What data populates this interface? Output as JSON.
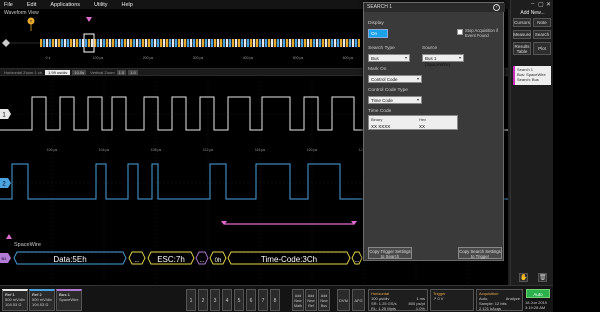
{
  "menu": [
    "File",
    "Edit",
    "Applications",
    "Utility",
    "Help"
  ],
  "waveform": {
    "title": "Waveform View",
    "zoom_bar": {
      "horizontal_zoom_label": "Horizontal Zoom 1 ch",
      "horizontal_zoom_value": "1.99 us/div",
      "position_label": "10.0s",
      "position_value": "10.0s",
      "vertical_zoom_label": "Vertical Zoom",
      "vertical_zoom_value": "1.0",
      "extra": "1.0"
    },
    "overview_ticks": [
      "0 s",
      "100 µs",
      "200 µs",
      "300 µs",
      "400 µs",
      "500 µs",
      "600 µs"
    ],
    "time_ticks": [
      "100 µs",
      "104 µs",
      "108 µs",
      "112 µs",
      "116 µs",
      "120 µs",
      "124 µs",
      "128 µs",
      "132 µs"
    ],
    "channel_labels": [
      "1",
      "2"
    ],
    "bus_label": "B1",
    "bus_name": "SpaceWire",
    "decode": [
      {
        "text": "Data:5Eh"
      },
      {
        "text": "..."
      },
      {
        "text": "ESC:7h"
      },
      {
        "text": "..."
      },
      {
        "text": "0h"
      },
      {
        "text": "Time-Code:3Ch"
      },
      {
        "text": "..."
      }
    ],
    "colors": {
      "ch1": "#e8e8e8",
      "ch2": "#4aa3e0",
      "bus": "#e9d64a",
      "search": "#e36ad2"
    }
  },
  "dialog": {
    "title": "SEARCH 1",
    "display_label": "Display",
    "display_toggle": "On",
    "stop_label": "Stop Acquisition if Event Found",
    "search_type_label": "Search Type",
    "search_type_value": "Bus",
    "source_label": "Source",
    "source_value": "Bus 1 (SpaceWire)",
    "mark_on_label": "Mark On",
    "mark_on_value": "Control Code",
    "control_code_type_label": "Control Code Type",
    "control_code_type_value": "Time Code",
    "time_code_label": "Time Code",
    "binary_label": "Binary",
    "binary_value": "XX XXXX",
    "hex_label": "Hex",
    "hex_value": "XX",
    "copy_trigger_label": "Copy Trigger Settings to Search",
    "copy_search_label": "Copy Search Settings to Trigger"
  },
  "rightpanel": {
    "add_new": "Add New...",
    "buttons": [
      "Cursors",
      "Note",
      "Measure",
      "Search",
      "Results Table",
      "Plot"
    ],
    "search_card_title": "Search 1",
    "search_card_lines": [
      "Bus: SpaceWire",
      "Search: Bus",
      "Events: 1"
    ]
  },
  "bottom": {
    "channels": [
      {
        "title": "Ref 1",
        "lines": [
          "500 mV/div",
          "104.53 Ω",
          "specimen"
        ]
      },
      {
        "title": "Ref 2",
        "lines": [
          "500 mV/div",
          "104.53 Ω",
          "specimen"
        ]
      },
      {
        "title": "Bus 1",
        "lines": [
          "SpaceWire"
        ]
      }
    ],
    "numbers": [
      "1",
      "2",
      "3",
      "4",
      "5",
      "6",
      "7",
      "8"
    ],
    "add_buttons": [
      "Add New Math",
      "Add New Ref",
      "Add New Bus"
    ],
    "dvm": "DVM",
    "afg": "AFG",
    "horizontal": {
      "title": "Horizontal",
      "lines": [
        "100 µs/div",
        "SR: 1.25 GS/s",
        "RL: 1.25 Mpts"
      ],
      "extra": [
        "1 ms",
        "800 ps/pt",
        "1.0%"
      ]
    },
    "trigger": {
      "title": "Trigger",
      "lines": [
        "↗ 0 V"
      ]
    },
    "acquisition": {
      "title": "Acquisition",
      "lines": [
        "Auto,",
        "Sample: 12 bits",
        "2.121 kAcqs"
      ],
      "extra": [
        "Analyze"
      ]
    },
    "run": "Auto",
    "date": "18 Jun 2019",
    "time": "3:19:28 AM"
  }
}
